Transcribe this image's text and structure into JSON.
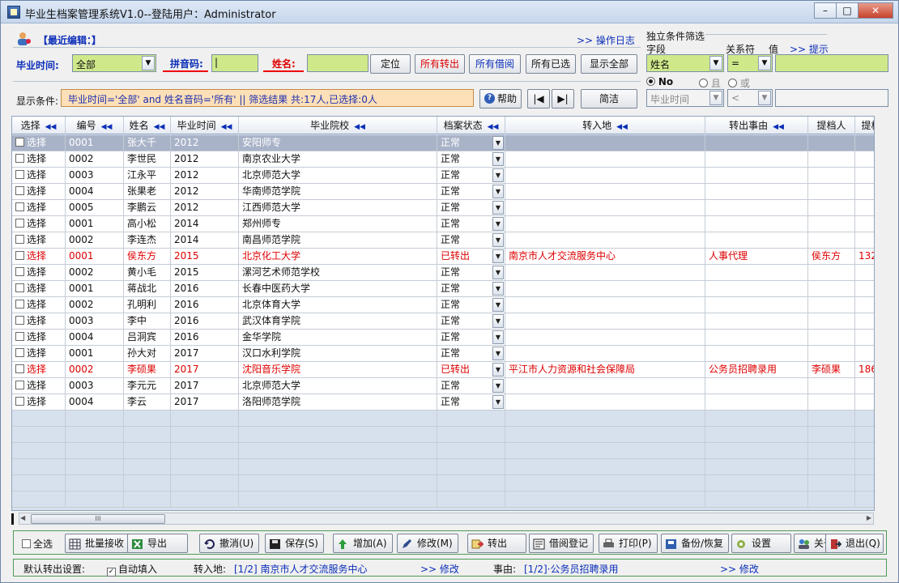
{
  "window": {
    "title": "毕业生档案管理系统V1.0--登陆用户：Administrator"
  },
  "top": {
    "recent_edit": "【最近编辑：】",
    "op_log": ">> 操作日志",
    "grad_time_label": "毕业时间:",
    "grad_time_value": "全部",
    "pinyin_label": "拼音码:",
    "pinyin_value": "|",
    "name_label": "姓名:",
    "btn_locate": "定位",
    "btn_all_out": "所有转出",
    "btn_all_borrow": "所有借阅",
    "btn_all_selected": "所有已选",
    "btn_show_all": "显示全部",
    "cond_label": "显示条件:",
    "cond_text": "毕业时间='全部' and 姓名音码='所有' || 筛选结果 共:17人,已选择:0人",
    "btn_help": "帮助",
    "btn_first": "|◀",
    "btn_last": "▶|",
    "btn_simple": "简洁"
  },
  "filter": {
    "title": "独立条件筛选",
    "field_label": "字段",
    "op_label": "关系符",
    "val_label": "值",
    "hint": ">> 提示",
    "field_value": "姓名",
    "op_value": "=",
    "radio_no": "No",
    "radio_and": "且",
    "radio_or": "或",
    "field2_value": "毕业时间",
    "op2_value": "<"
  },
  "table": {
    "headers": [
      "选择",
      "编号",
      "姓名",
      "毕业时间",
      "毕业院校",
      "档案状态",
      "转入地",
      "转出事由",
      "提档人",
      "提档"
    ],
    "check_label": "选择",
    "rows": [
      {
        "id": "0001",
        "name": "张大千",
        "year": "2012",
        "school": "安阳师专",
        "status": "正常",
        "to": "",
        "reason": "",
        "person": "",
        "extra": ""
      },
      {
        "id": "0002",
        "name": "李世民",
        "year": "2012",
        "school": "南京农业大学",
        "status": "正常",
        "to": "",
        "reason": "",
        "person": "",
        "extra": ""
      },
      {
        "id": "0003",
        "name": "江永平",
        "year": "2012",
        "school": "北京师范大学",
        "status": "正常",
        "to": "",
        "reason": "",
        "person": "",
        "extra": ""
      },
      {
        "id": "0004",
        "name": "张果老",
        "year": "2012",
        "school": "华南师范学院",
        "status": "正常",
        "to": "",
        "reason": "",
        "person": "",
        "extra": ""
      },
      {
        "id": "0005",
        "name": "李鹏云",
        "year": "2012",
        "school": "江西师范大学",
        "status": "正常",
        "to": "",
        "reason": "",
        "person": "",
        "extra": ""
      },
      {
        "id": "0001",
        "name": "高小松",
        "year": "2014",
        "school": "郑州师专",
        "status": "正常",
        "to": "",
        "reason": "",
        "person": "",
        "extra": ""
      },
      {
        "id": "0002",
        "name": "李连杰",
        "year": "2014",
        "school": "南昌师范学院",
        "status": "正常",
        "to": "",
        "reason": "",
        "person": "",
        "extra": ""
      },
      {
        "id": "0001",
        "name": "侯东方",
        "year": "2015",
        "school": "北京化工大学",
        "status": "已转出",
        "to": "南京市人才交流服务中心",
        "reason": "人事代理",
        "person": "侯东方",
        "extra": "132"
      },
      {
        "id": "0002",
        "name": "黄小毛",
        "year": "2015",
        "school": "漯河艺术师范学校",
        "status": "正常",
        "to": "",
        "reason": "",
        "person": "",
        "extra": ""
      },
      {
        "id": "0001",
        "name": "蒋战北",
        "year": "2016",
        "school": "长春中医药大学",
        "status": "正常",
        "to": "",
        "reason": "",
        "person": "",
        "extra": ""
      },
      {
        "id": "0002",
        "name": "孔明利",
        "year": "2016",
        "school": "北京体育大学",
        "status": "正常",
        "to": "",
        "reason": "",
        "person": "",
        "extra": ""
      },
      {
        "id": "0003",
        "name": "李中",
        "year": "2016",
        "school": "武汉体育学院",
        "status": "正常",
        "to": "",
        "reason": "",
        "person": "",
        "extra": ""
      },
      {
        "id": "0004",
        "name": "吕洞宾",
        "year": "2016",
        "school": "金华学院",
        "status": "正常",
        "to": "",
        "reason": "",
        "person": "",
        "extra": ""
      },
      {
        "id": "0001",
        "name": "孙大对",
        "year": "2017",
        "school": "汉口水利学院",
        "status": "正常",
        "to": "",
        "reason": "",
        "person": "",
        "extra": ""
      },
      {
        "id": "0002",
        "name": "李硕果",
        "year": "2017",
        "school": "沈阳音乐学院",
        "status": "已转出",
        "to": "平江市人力资源和社会保障局",
        "reason": "公务员招聘录用",
        "person": "李硕果",
        "extra": "186"
      },
      {
        "id": "0003",
        "name": "李元元",
        "year": "2017",
        "school": "北京师范大学",
        "status": "正常",
        "to": "",
        "reason": "",
        "person": "",
        "extra": ""
      },
      {
        "id": "0004",
        "name": "李云",
        "year": "2017",
        "school": "洛阳师范学院",
        "status": "正常",
        "to": "",
        "reason": "",
        "person": "",
        "extra": ""
      }
    ]
  },
  "toolbar": {
    "select_all": "全选",
    "batch_receive": "批量接收",
    "export": "导出",
    "undo": "撤消(U)",
    "save": "保存(S)",
    "add": "增加(A)",
    "edit": "修改(M)",
    "transfer_out": "转出",
    "borrow": "借阅登记",
    "print": "打印(P)",
    "backup": "备份/恢复",
    "settings": "设置",
    "about": "关于",
    "exit": "退出(Q)"
  },
  "status": {
    "default_label": "默认转出设置:",
    "auto_fill": "自动填入",
    "to_label": "转入地:",
    "to_value": "[1/2] 南京市人才交流服务中心",
    "edit1": ">> 修改",
    "reason_label": "事由:",
    "reason_value": "[1/2]·公务员招聘录用",
    "edit2": ">> 修改"
  }
}
